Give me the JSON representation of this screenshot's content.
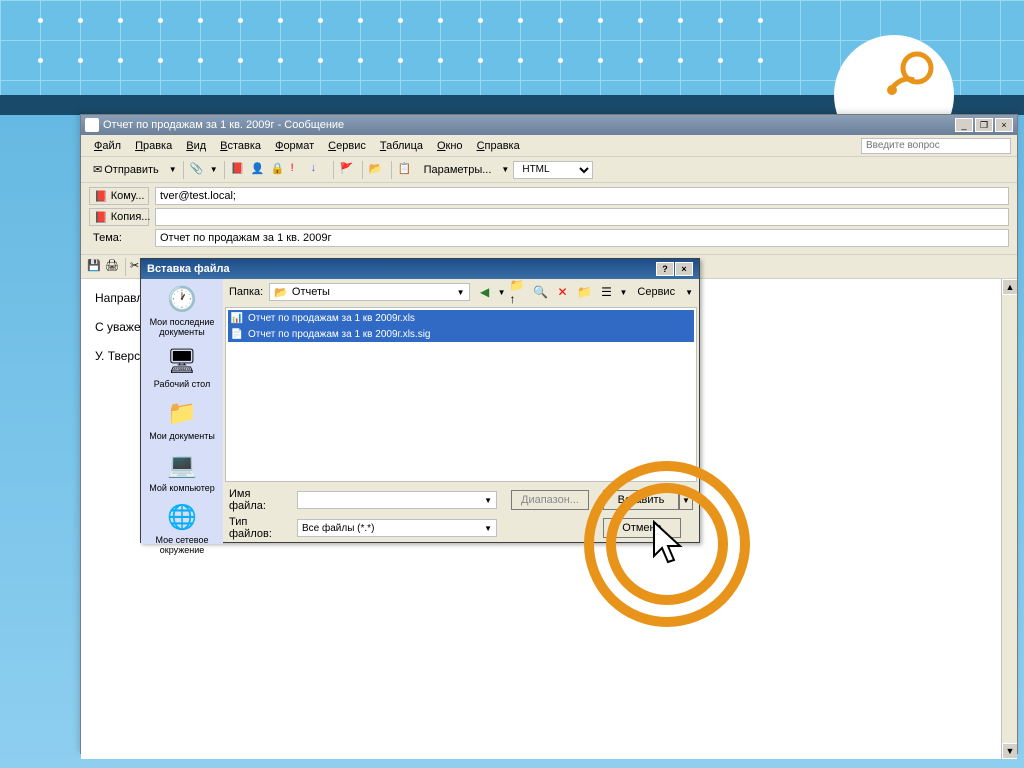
{
  "outlook": {
    "title": "Отчет по продажам за 1 кв. 2009г - Сообщение",
    "menubar": [
      "Файл",
      "Правка",
      "Вид",
      "Вставка",
      "Формат",
      "Сервис",
      "Таблица",
      "Окно",
      "Справка"
    ],
    "help_placeholder": "Введите вопрос",
    "send_label": "Отправить",
    "params_label": "Параметры...",
    "format_mode": "HTML",
    "to_label": "Кому...",
    "cc_label": "Копия...",
    "subject_label": "Тема:",
    "to_value": "tver@test.local;",
    "cc_value": "",
    "subject_value": "Отчет по продажам за 1 кв. 2009г",
    "font_name": "Arial",
    "font_size": "10",
    "body_lines": [
      "Направляю",
      "С уважением",
      "У. Тверская"
    ]
  },
  "dialog": {
    "title": "Вставка файла",
    "folder_label": "Папка:",
    "folder_value": "Отчеты",
    "service_label": "Сервис",
    "sidebar": [
      {
        "label": "Мои последние документы"
      },
      {
        "label": "Рабочий стол"
      },
      {
        "label": "Мои документы"
      },
      {
        "label": "Мой компьютер"
      },
      {
        "label": "Мое сетевое окружение"
      }
    ],
    "files": [
      {
        "name": "Отчет по продажам за 1 кв 2009г.xls"
      },
      {
        "name": "Отчет по продажам за 1 кв 2009г.xls.sig"
      }
    ],
    "filename_label": "Имя файла:",
    "filename_value": "",
    "filetype_label": "Тип файлов:",
    "filetype_value": "Все файлы (*.*)",
    "range_btn": "Диапазон...",
    "insert_btn": "Вставить",
    "cancel_btn": "Отмена"
  }
}
